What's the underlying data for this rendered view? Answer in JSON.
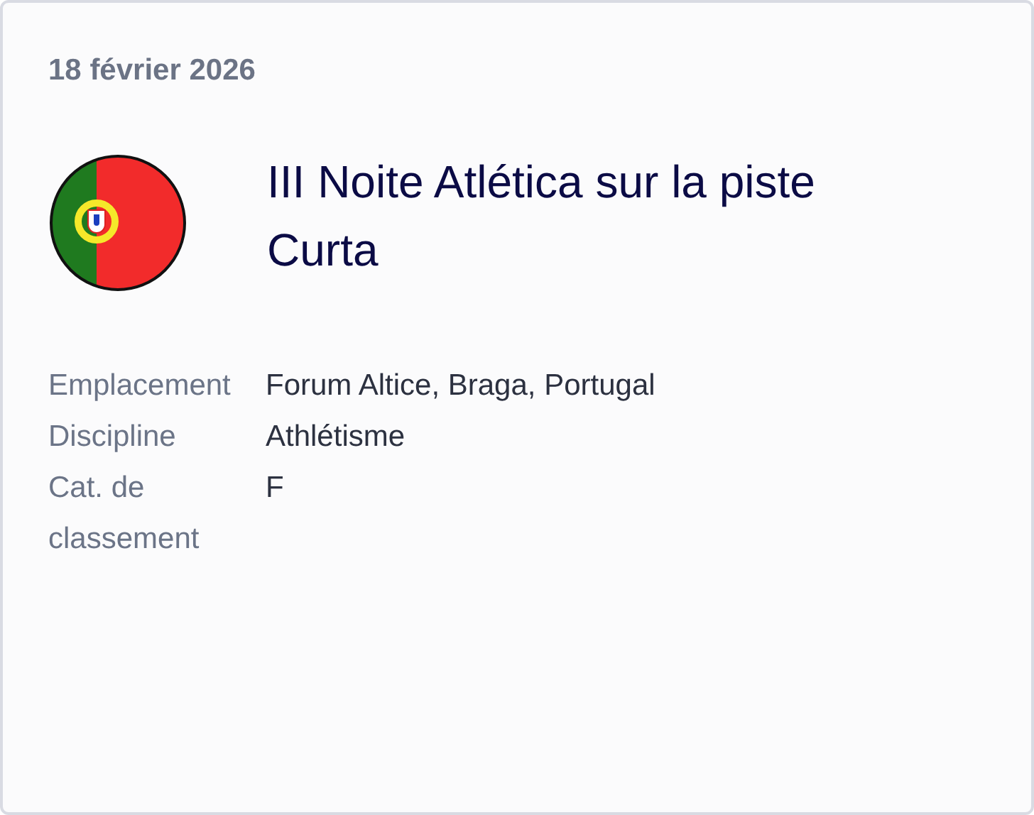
{
  "date": "18 février 2026",
  "title": "III Noite Atlética sur la piste Curta",
  "details": [
    {
      "label": "Emplacement",
      "value": "Forum Altice, Braga, Portugal"
    },
    {
      "label": "Discipline",
      "value": "Athlétisme"
    },
    {
      "label": "Cat. de classement",
      "value": "F"
    }
  ]
}
